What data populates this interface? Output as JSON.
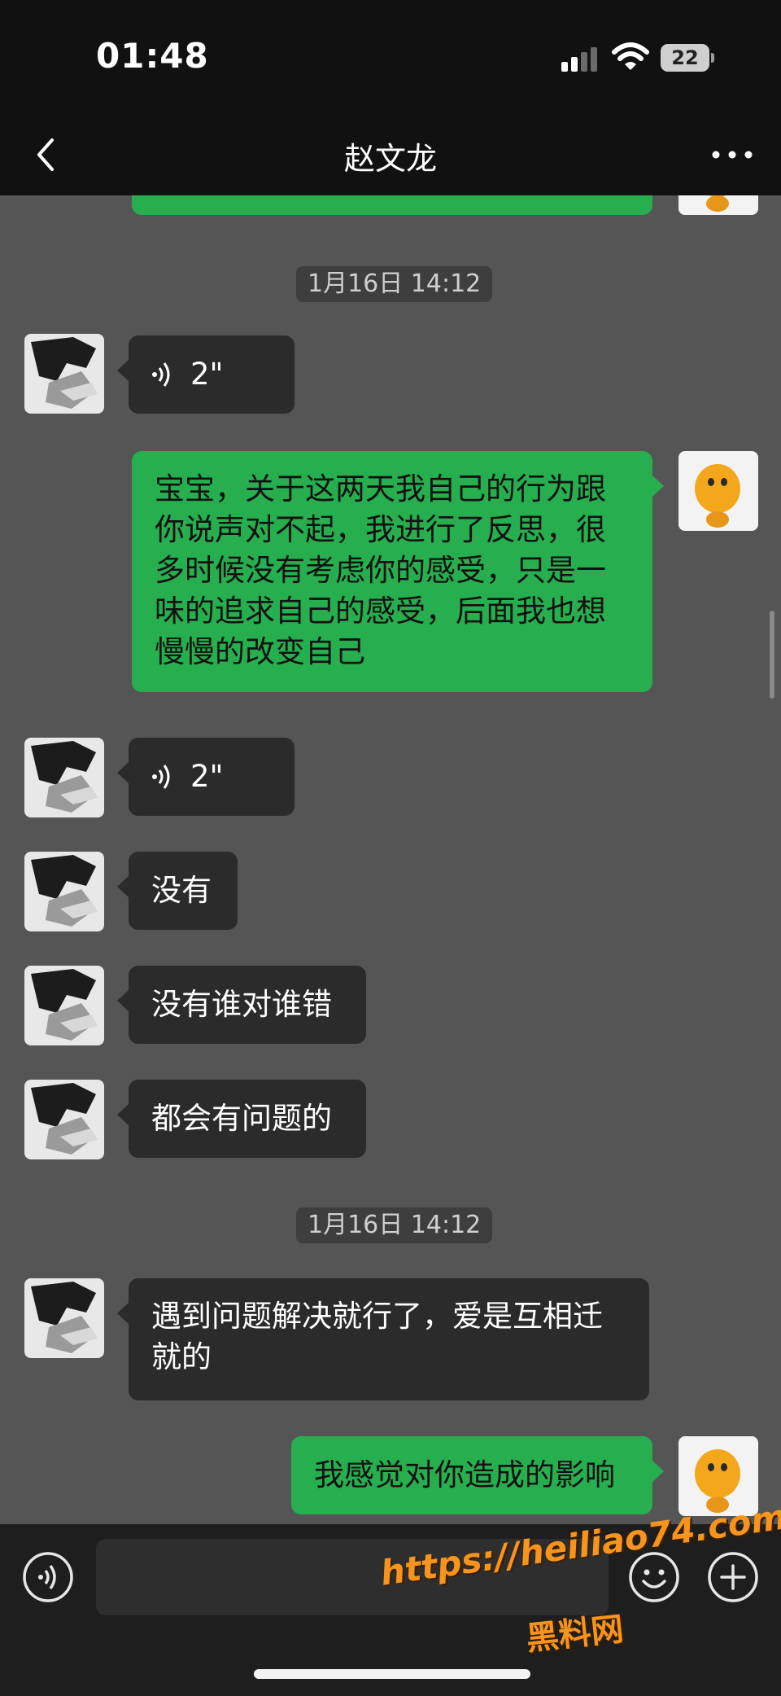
{
  "status_bar": {
    "time": "01:48",
    "battery": "22"
  },
  "header": {
    "title": "赵文龙"
  },
  "messages": [
    {
      "side": "outgoing",
      "kind": "text",
      "text": ""
    },
    {
      "kind": "timestamp",
      "text": "1月16日 14:12"
    },
    {
      "side": "incoming",
      "kind": "voice",
      "duration": "2\""
    },
    {
      "side": "outgoing",
      "kind": "text",
      "text": "宝宝，关于这两天我自己的行为跟你说声对不起，我进行了反思，很多时候没有考虑你的感受，只是一味的追求自己的感受，后面我也想慢慢的改变自己"
    },
    {
      "side": "incoming",
      "kind": "voice",
      "duration": "2\""
    },
    {
      "side": "incoming",
      "kind": "text",
      "text": "没有"
    },
    {
      "side": "incoming",
      "kind": "text",
      "text": "没有谁对谁错"
    },
    {
      "side": "incoming",
      "kind": "text",
      "text": "都会有问题的"
    },
    {
      "kind": "timestamp",
      "text": "1月16日 14:12"
    },
    {
      "side": "incoming",
      "kind": "text",
      "text": "遇到问题解决就行了，爱是互相迁就的"
    },
    {
      "side": "outgoing",
      "kind": "text",
      "text": "我感觉对你造成的影响"
    }
  ],
  "input_bar": {
    "placeholder": ""
  },
  "watermark": {
    "url": "https://heiliao74.com",
    "name": "黑料网"
  },
  "icons": {
    "back": "chevron-left-icon",
    "more": "more-dots-icon",
    "voice_toggle": "voice-toggle-icon",
    "emoji": "emoji-icon",
    "plus": "plus-icon"
  },
  "colors": {
    "chat_background": "#555555",
    "incoming_bubble": "#2b2b2b",
    "outgoing_bubble": "#27ae4f",
    "bar_background": "#111111"
  }
}
